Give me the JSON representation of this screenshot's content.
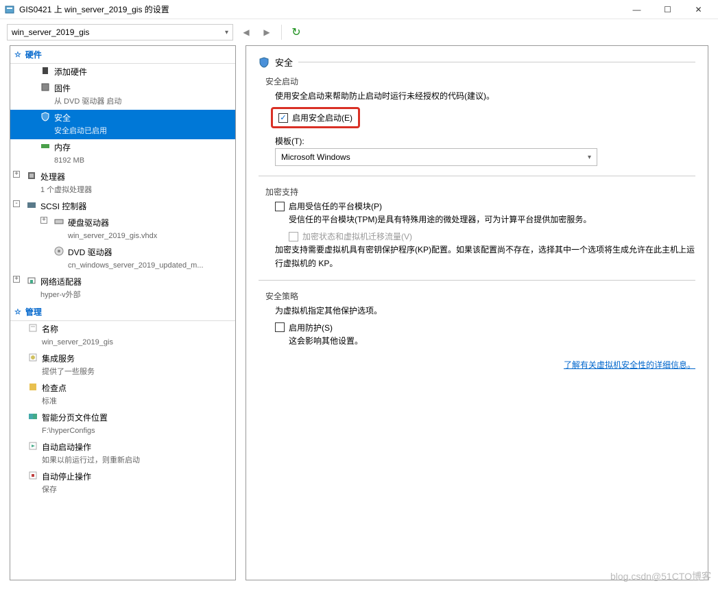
{
  "window": {
    "title": "GIS0421 上 win_server_2019_gis 的设置"
  },
  "toolbar": {
    "combo_value": "win_server_2019_gis"
  },
  "sidebar": {
    "cat_hardware": "硬件",
    "cat_management": "管理",
    "items": {
      "add_hw": {
        "label": "添加硬件"
      },
      "firmware": {
        "label": "固件",
        "sub": "从 DVD 驱动器 启动"
      },
      "security": {
        "label": "安全",
        "sub": "安全启动已启用"
      },
      "memory": {
        "label": "内存",
        "sub": "8192 MB"
      },
      "processor": {
        "label": "处理器",
        "sub": "1 个虚拟处理器"
      },
      "scsi": {
        "label": "SCSI 控制器"
      },
      "hdd": {
        "label": "硬盘驱动器",
        "sub": "win_server_2019_gis.vhdx"
      },
      "dvd": {
        "label": "DVD 驱动器",
        "sub": "cn_windows_server_2019_updated_m..."
      },
      "nic": {
        "label": "网络适配器",
        "sub": "hyper-v外部"
      },
      "name": {
        "label": "名称",
        "sub": "win_server_2019_gis"
      },
      "integ": {
        "label": "集成服务",
        "sub": "提供了一些服务"
      },
      "checkpoint": {
        "label": "检查点",
        "sub": "标准"
      },
      "paging": {
        "label": "智能分页文件位置",
        "sub": "F:\\hyperConfigs"
      },
      "autostart": {
        "label": "自动启动操作",
        "sub": "如果以前运行过，则重新启动"
      },
      "autostop": {
        "label": "自动停止操作",
        "sub": "保存"
      }
    }
  },
  "panel": {
    "title": "安全",
    "secure_boot": {
      "section": "安全启动",
      "desc": "使用安全启动来帮助防止启动时运行未经授权的代码(建议)。",
      "checkbox": "启用安全启动(E)",
      "template_label": "模板(T):",
      "template_value": "Microsoft Windows"
    },
    "encryption": {
      "section": "加密支持",
      "tpm_checkbox": "启用受信任的平台模块(P)",
      "tpm_desc": "受信任的平台模块(TPM)是具有特殊用途的微处理器，可为计算平台提供加密服务。",
      "traffic_checkbox": "加密状态和虚拟机迁移流量(V)",
      "kp_desc": "加密支持需要虚拟机具有密钥保护程序(KP)配置。如果该配置尚不存在，选择其中一个选项将生成允许在此主机上运行虚拟机的 KP。"
    },
    "policy": {
      "section": "安全策略",
      "desc": "为虚拟机指定其他保护选项。",
      "shield_checkbox": "启用防护(S)",
      "shield_desc": "这会影响其他设置。"
    },
    "link": "了解有关虚拟机安全性的详细信息。"
  },
  "watermark": "blog.csdn@51CTO博客"
}
